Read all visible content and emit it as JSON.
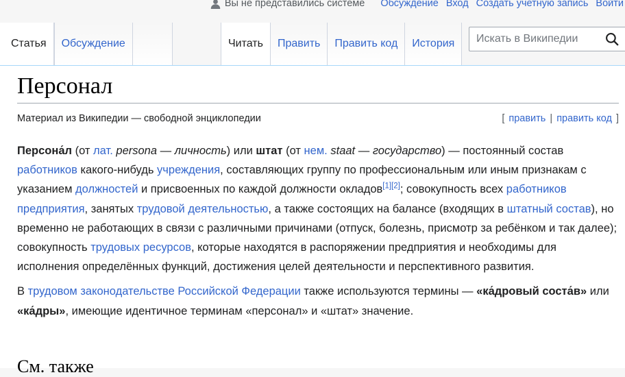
{
  "personal": {
    "anon": "Вы не представились системе",
    "talk": "Обсуждение",
    "login": "Вход",
    "create": "Создать учетную запись",
    "logout": "Войти"
  },
  "tabs": {
    "left": [
      "Статья",
      "Обсуждение"
    ],
    "right": [
      "Читать",
      "Править",
      "Править код",
      "История"
    ],
    "selected": "Статья"
  },
  "search": {
    "placeholder": "Искать в Википедии"
  },
  "page": {
    "title": "Персонал",
    "site_sub": "Материал из Википедии — свободной энциклопедии",
    "edit_open": "[",
    "edit": "править",
    "edit_sep": "|",
    "edit_code": "править код",
    "edit_close": "]"
  },
  "p1": {
    "t1": "Персона́л",
    "t2": " (от ",
    "l_lat": "лат.",
    "t3": " ",
    "i1": "persona",
    "t4": " — ",
    "i2": "личность",
    "t5": ") или ",
    "b2": "штат",
    "t6": " (от ",
    "l_nem": "нем.",
    "t7": " ",
    "i3": "staat",
    "t8": " — ",
    "i4": "государство",
    "t9": ") — постоянный состав ",
    "l1": "работников",
    "t10": " какого-нибудь ",
    "l2": "учреждения",
    "t11": ", составляющих группу по профессиональным или иным признакам с указанием ",
    "l3": "должностей",
    "t12": " и присвоенных по каждой должности окладов",
    "ref1": "[1]",
    "ref2": "[2]",
    "t13": "; совокупность всех ",
    "l4": "работников предприятия",
    "t14": ", занятых ",
    "l5": "трудовой деятельностью",
    "t15": ", а также состоящих на балансе (входящих в ",
    "l6": "штатный состав",
    "t16": "), но временно не работающих в связи с различными причинами (отпуск, болезнь, присмотр за ребёнком и так далее); совокупность ",
    "l7": "трудовых ресурсов",
    "t17": ", которые находятся в распоряжении предприятия и необходимы для исполнения определённых функций, достижения целей деятельности и перспективного развития."
  },
  "p2": {
    "t1": "В ",
    "l1": "трудовом законодательстве Российской Федерации",
    "t2": " также используются термины — ",
    "b1": "«ка́дровый соста́в»",
    "t3": " или ",
    "b2": "«ка́дры»",
    "t4": ", имеющие идентичное терминам «персонал» и «штат» значение."
  },
  "next_heading": "См. также"
}
